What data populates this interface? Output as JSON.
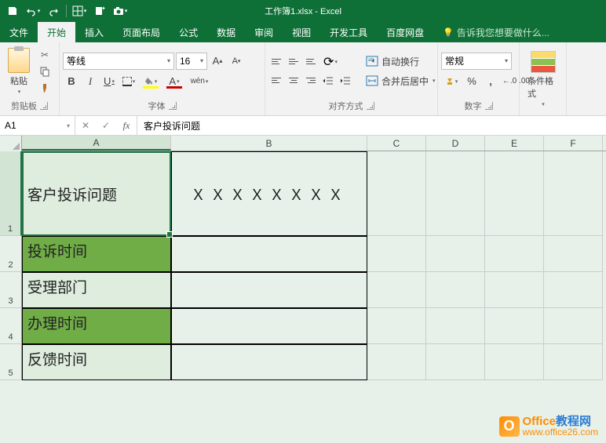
{
  "title": "工作簿1.xlsx - Excel",
  "tabs": [
    "文件",
    "开始",
    "插入",
    "页面布局",
    "公式",
    "数据",
    "审阅",
    "视图",
    "开发工具",
    "百度网盘"
  ],
  "tell_me": "告诉我您想要做什么...",
  "ribbon": {
    "clipboard": {
      "label": "剪贴板",
      "paste": "粘贴"
    },
    "font": {
      "label": "字体",
      "name": "等线",
      "size": "16",
      "bold": "B",
      "italic": "I",
      "underline": "U",
      "wen": "wén"
    },
    "align": {
      "label": "对齐方式",
      "wrap": "自动换行",
      "merge": "合并后居中"
    },
    "number": {
      "label": "数字",
      "format": "常规"
    },
    "styles": {
      "cf": "条件格式"
    }
  },
  "fbar": {
    "ref": "A1",
    "formula": "客户投诉问题"
  },
  "columns": [
    "A",
    "B",
    "C",
    "D",
    "E",
    "F"
  ],
  "rows": [
    "1",
    "2",
    "3",
    "4",
    "5"
  ],
  "data": {
    "a1": "客户投诉问题",
    "b1": "ＸＸＸＸＸＸＸＸ",
    "a2": "投诉时间",
    "a3": "受理部门",
    "a4": "办理时间",
    "a5": "反馈时间"
  },
  "watermark": {
    "brand": "Office",
    "suffix": "教程网",
    "url": "www.office26.com"
  }
}
